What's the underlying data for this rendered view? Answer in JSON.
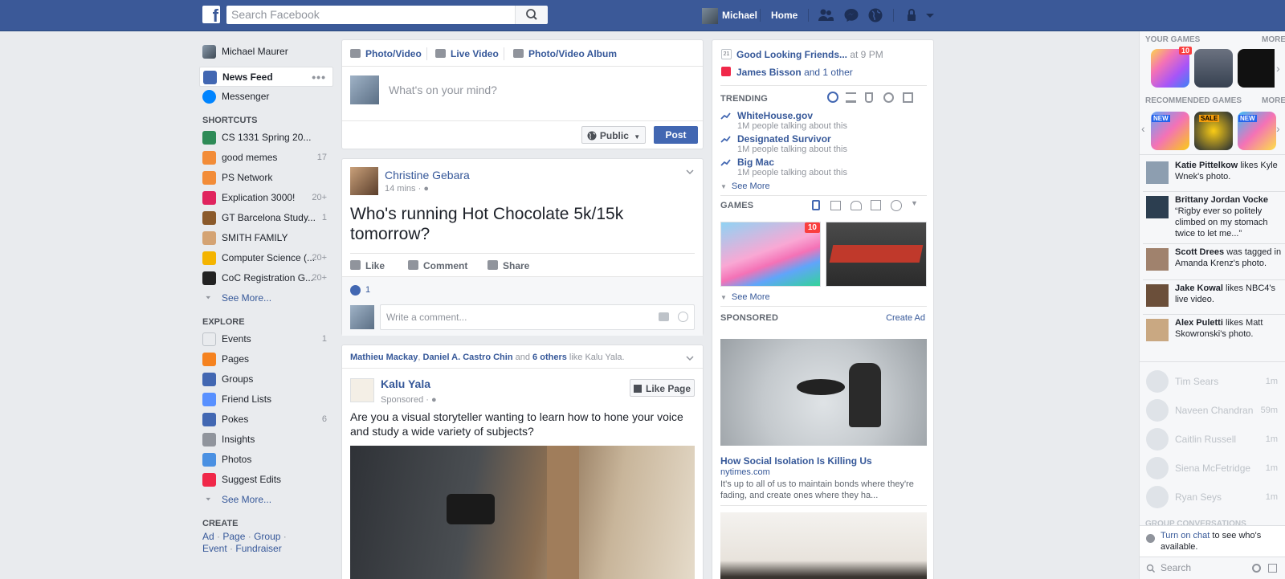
{
  "topbar": {
    "logo": "f",
    "search_placeholder": "Search Facebook",
    "user_name": "Michael",
    "home": "Home"
  },
  "leftnav": {
    "profile": "Michael Maurer",
    "main": [
      {
        "label": "News Feed",
        "icon": "news-feed-icon",
        "color": "#4267b2"
      },
      {
        "label": "Messenger",
        "icon": "messenger-icon",
        "color": "#0084ff"
      }
    ],
    "shortcuts_heading": "SHORTCUTS",
    "shortcuts": [
      {
        "label": "CS 1331 Spring 20...",
        "count": "",
        "color": "#2e8b57"
      },
      {
        "label": "good memes",
        "count": "17",
        "color": "#f28c38"
      },
      {
        "label": "PS Network",
        "count": "",
        "color": "#f28c38"
      },
      {
        "label": "Explication 3000!",
        "count": "20+",
        "color": "#e0245e"
      },
      {
        "label": "GT Barcelona Study...",
        "count": "1",
        "color": "#8b5a2b"
      },
      {
        "label": "SMITH FAMILY",
        "count": "",
        "color": "#d4a373"
      },
      {
        "label": "Computer Science (...",
        "count": "20+",
        "color": "#f4b400"
      },
      {
        "label": "CoC Registration G...",
        "count": "20+",
        "color": "#222222"
      }
    ],
    "shortcuts_see_more": "See More...",
    "explore_heading": "EXPLORE",
    "explore": [
      {
        "label": "Events",
        "count": "1",
        "icon": "events-icon",
        "color": "#e9ebee"
      },
      {
        "label": "Pages",
        "count": "",
        "icon": "pages-icon",
        "color": "#f5821f"
      },
      {
        "label": "Groups",
        "count": "",
        "icon": "groups-icon",
        "color": "#4267b2"
      },
      {
        "label": "Friend Lists",
        "count": "",
        "icon": "friend-lists-icon",
        "color": "#5890ff"
      },
      {
        "label": "Pokes",
        "count": "6",
        "icon": "pokes-icon",
        "color": "#4267b2"
      },
      {
        "label": "Insights",
        "count": "",
        "icon": "insights-icon",
        "color": "#90949c"
      },
      {
        "label": "Photos",
        "count": "",
        "icon": "photos-icon",
        "color": "#4a90e2"
      },
      {
        "label": "Suggest Edits",
        "count": "",
        "icon": "suggest-edits-icon",
        "color": "#f02849"
      }
    ],
    "explore_see_more": "See More...",
    "create_heading": "CREATE",
    "create_links": [
      "Ad",
      "Page",
      "Group",
      "Event",
      "Fundraiser"
    ]
  },
  "composer": {
    "tabs": [
      "Photo/Video",
      "Live Video",
      "Photo/Video Album"
    ],
    "placeholder": "What's on your mind?",
    "privacy": "Public",
    "post_button": "Post"
  },
  "post1": {
    "author": "Christine Gebara",
    "time": "14 mins",
    "text": "Who's running Hot Chocolate 5k/15k tomorrow?",
    "like": "Like",
    "comment": "Comment",
    "share": "Share",
    "likes_count": "1",
    "comment_placeholder": "Write a comment..."
  },
  "post2": {
    "social_a": "Mathieu Mackay",
    "social_b": "Daniel A. Castro Chin",
    "social_and": "and",
    "social_others": "6 others",
    "social_like": "like Kalu Yala.",
    "page_name": "Kalu Yala",
    "sponsored": "Sponsored",
    "like_page": "Like Page",
    "text": "Are you a visual storyteller wanting to learn how to hone your voice and study a wide variety of subjects?"
  },
  "right": {
    "event_name": "Good Looking Friends...",
    "event_time": "at 9 PM",
    "birthday_name": "James Bisson",
    "birthday_rest": "and 1 other",
    "trending_heading": "TRENDING",
    "trending": [
      {
        "name": "WhiteHouse.gov",
        "sub": "1M people talking about this"
      },
      {
        "name": "Designated Survivor",
        "sub": "1M people talking about this"
      },
      {
        "name": "Big Mac",
        "sub": "1M people talking about this"
      }
    ],
    "trending_see_more": "See More",
    "games_heading": "GAMES",
    "games_badge": "10",
    "games_see_more": "See More",
    "sponsored_heading": "SPONSORED",
    "create_ad": "Create Ad",
    "ad_title": "How Social Isolation Is Killing Us",
    "ad_domain": "nytimes.com",
    "ad_desc": "It's up to all of us to maintain bonds where they're fading, and create ones where they ha..."
  },
  "rail": {
    "your_games": "YOUR GAMES",
    "more1": "MORE",
    "recommended": "RECOMMENDED GAMES",
    "more2": "MORE",
    "badge": "10",
    "rec_badges": [
      "NEW",
      "SALE",
      "NEW"
    ],
    "ticker": [
      {
        "name": "Katie Pittelkow",
        "rest": "likes Kyle Wnek's photo."
      },
      {
        "name": "Brittany Jordan Vocke",
        "rest": "“Rigby ever so politely climbed on my stomach twice to let me...”"
      },
      {
        "name": "Scott Drees",
        "rest": "was tagged in Amanda Krenz's photo."
      },
      {
        "name": "Jake Kowal",
        "rest": "likes NBC4's live video."
      },
      {
        "name": "Alex Puletti",
        "rest": "likes Matt Skowronski's photo."
      }
    ],
    "contacts": [
      {
        "name": "Tim Sears",
        "time": "1m"
      },
      {
        "name": "Naveen Chandran",
        "time": "59m"
      },
      {
        "name": "Caitlin Russell",
        "time": "1m"
      },
      {
        "name": "Siena McFetridge",
        "time": "1m"
      },
      {
        "name": "Ryan Seys",
        "time": "1m"
      }
    ],
    "group_conv": "GROUP CONVERSATIONS",
    "turn_on_chat": "Turn on chat",
    "chat_rest": "to see who's available.",
    "search": "Search"
  }
}
